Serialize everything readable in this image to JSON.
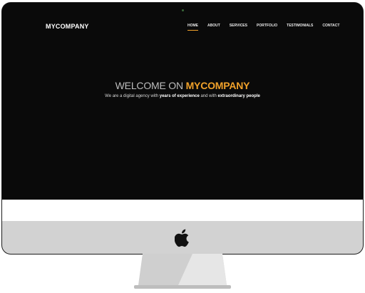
{
  "site": {
    "brand": "MYCOMPANY",
    "nav": {
      "items": [
        {
          "label": "HOME",
          "active": true
        },
        {
          "label": "ABOUT"
        },
        {
          "label": "SERVICES"
        },
        {
          "label": "PORTFOLIO"
        },
        {
          "label": "TESTIMONIALS"
        },
        {
          "label": "CONTACT"
        }
      ]
    },
    "hero": {
      "title_prefix": "WELCOME ON ",
      "title_accent": "MYCOMPANY",
      "sub_1": "We are a digital agency with ",
      "sub_2": "years of experience",
      "sub_3": " and with ",
      "sub_4": "extraordinary people"
    }
  },
  "colors": {
    "accent": "#f0a12a",
    "screen_bg": "#0a0a0a",
    "chin": "#d2d2d2"
  },
  "icons": {
    "device_logo": "apple-icon"
  }
}
